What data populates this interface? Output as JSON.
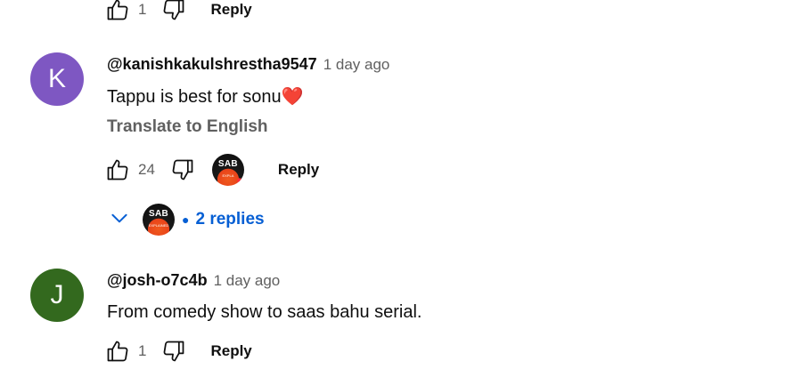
{
  "top_comment_actions": {
    "like_count": "1",
    "reply_label": "Reply"
  },
  "comments": [
    {
      "avatar_letter": "K",
      "avatar_color": "#7e57c2",
      "handle": "@kanishkakulshrestha9547",
      "time": "1 day ago",
      "text": "Tappu is best for sonu",
      "emoji": "❤️",
      "translate_label": "Translate to English",
      "like_count": "24",
      "reply_label": "Reply",
      "creator_heart": {
        "logo_text": "SAB",
        "logo_sub": "EXPLA"
      },
      "replies": {
        "label": "2 replies",
        "logo_text": "SAB",
        "logo_sub": "EXPLAINED"
      }
    },
    {
      "avatar_letter": "J",
      "avatar_color": "#33691e",
      "handle": "@josh-o7c4b",
      "time": "1 day ago",
      "text": "From comedy show to saas bahu serial.",
      "like_count": "1",
      "reply_label": "Reply"
    }
  ],
  "icons": [
    "thumbs-up-icon",
    "thumbs-down-icon",
    "chevron-down-icon",
    "heart-icon"
  ],
  "colors": {
    "link_blue": "#065fd4",
    "secondary_text": "#606060",
    "heart_red": "#ff2d3d"
  }
}
